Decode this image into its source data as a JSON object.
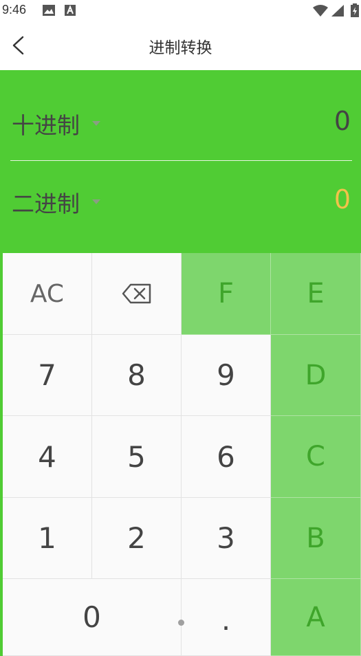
{
  "status": {
    "time": "9:46"
  },
  "header": {
    "title": "进制转换"
  },
  "converter": {
    "from": {
      "base_label": "十进制",
      "value": "0"
    },
    "to": {
      "base_label": "二进制",
      "value": "0"
    }
  },
  "keypad": {
    "row1": [
      "AC",
      "⌫",
      "F",
      "E"
    ],
    "row2": [
      "7",
      "8",
      "9",
      "D"
    ],
    "row3": [
      "4",
      "5",
      "6",
      "C"
    ],
    "row4": [
      "1",
      "2",
      "3",
      "B"
    ],
    "row5": [
      "0",
      ".",
      "A"
    ]
  },
  "colors": {
    "panel_green": "#50cc34",
    "key_green": "#7ed66d",
    "green_text": "#3fa52b",
    "result_value": "#f2c24a"
  }
}
